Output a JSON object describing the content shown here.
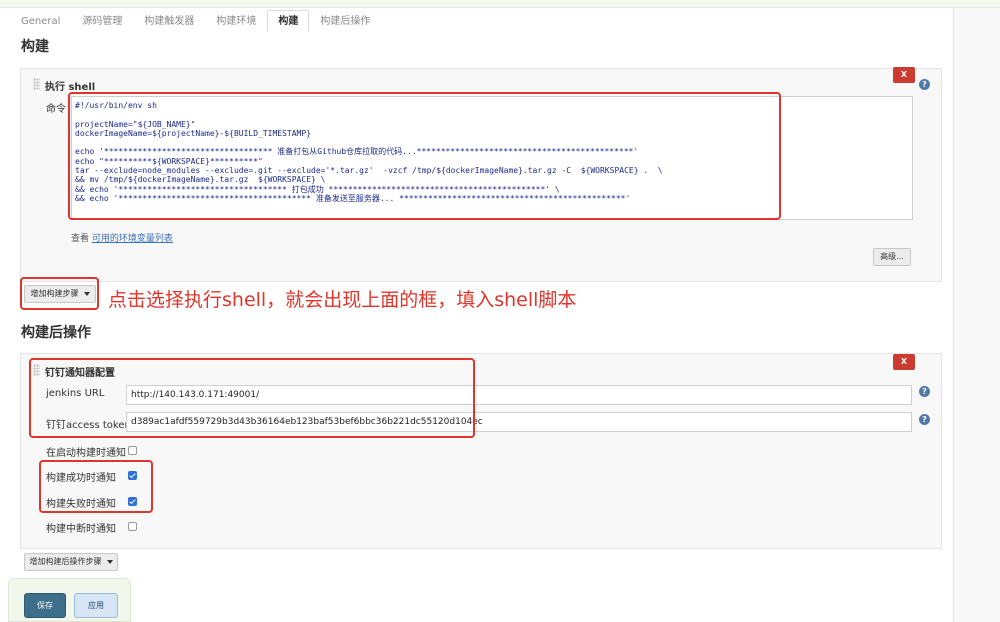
{
  "tabs": [
    {
      "label": "General",
      "active": false
    },
    {
      "label": "源码管理",
      "active": false
    },
    {
      "label": "构建触发器",
      "active": false
    },
    {
      "label": "构建环境",
      "active": false
    },
    {
      "label": "构建",
      "active": true
    },
    {
      "label": "构建后操作",
      "active": false
    }
  ],
  "build": {
    "section_title": "构建",
    "panel_title": "执行 shell",
    "delete_label": "X",
    "help_label": "?",
    "command_label": "命令",
    "command_lines": [
      "#!/usr/bin/env sh",
      "",
      "projectName=\"${JOB_NAME}\"",
      "dockerImageName=${projectName}-${BUILD_TIMESTAMP}",
      "",
      "echo '*********************************** 准备打包从Github仓库拉取的代码...*********************************************'",
      "echo \"**********${WORKSPACE}**********\"",
      "tar --exclude=node_modules --exclude=.git --exclude='*.tar.gz'  -vzcf /tmp/${dockerImageName}.tar.gz -C  ${WORKSPACE} .  \\",
      "&& mv /tmp/${dockerImageName}.tar.gz  ${WORKSPACE} \\",
      "&& echo '*********************************** 打包成功 *********************************************' \\",
      "&& echo '**************************************** 准备发送至服务器... ***********************************************'"
    ],
    "env_prefix": "查看 ",
    "env_link": "可用的环境变量列表",
    "advanced_label": "高级...",
    "add_step_label": "增加构建步骤"
  },
  "annotation": "点击选择执行shell，就会出现上面的框，填入shell脚本",
  "post_build": {
    "section_title": "构建后操作",
    "panel_title": "钉钉通知器配置",
    "delete_label": "X",
    "help_label": "?",
    "jenkins_url_label": "jenkins URL",
    "jenkins_url_value": "http://140.143.0.171:49001/",
    "token_label": "钉钉access token",
    "token_value": "d389ac1afdf559729b3d43b36164eb123baf53bef6bbc36b221dc55120d104ec",
    "checkboxes": [
      {
        "label": "在启动构建时通知",
        "checked": false
      },
      {
        "label": "构建成功时通知",
        "checked": true
      },
      {
        "label": "构建失败时通知",
        "checked": true
      },
      {
        "label": "构建中断时通知",
        "checked": false
      }
    ],
    "add_step_label": "增加构建后操作步骤"
  },
  "footer": {
    "save_label": "保存",
    "apply_label": "应用"
  }
}
